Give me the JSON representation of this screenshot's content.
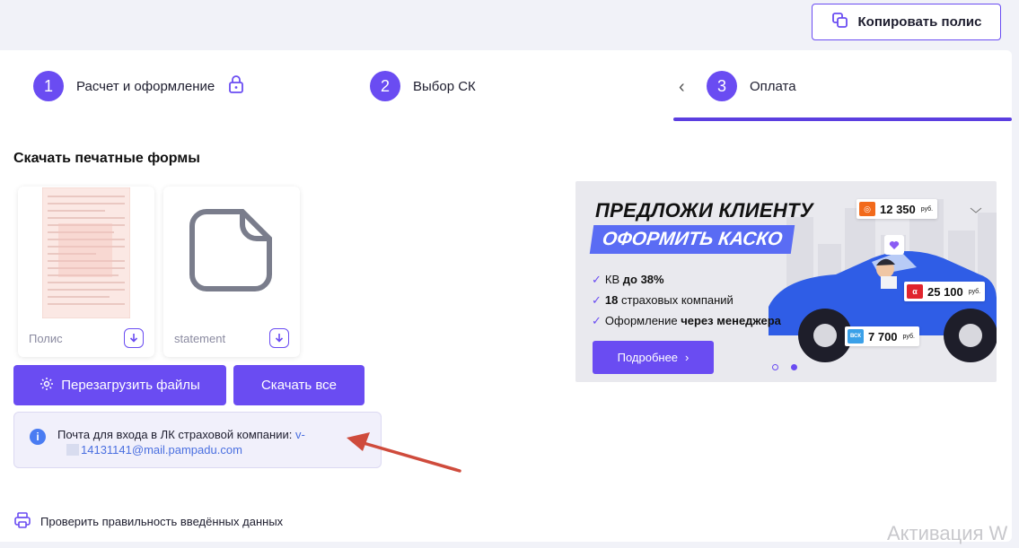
{
  "header": {
    "copy_button_label": "Копировать полис"
  },
  "stepper": {
    "steps": [
      {
        "num": "1",
        "label": "Расчет и оформление"
      },
      {
        "num": "2",
        "label": "Выбор СК"
      },
      {
        "num": "3",
        "label": "Оплата"
      }
    ],
    "active_step": 3
  },
  "downloads": {
    "title": "Скачать печатные формы",
    "files": [
      {
        "name": "Полис"
      },
      {
        "name": "statement"
      }
    ],
    "reload_button": "Перезагрузить файлы",
    "download_all_button": "Скачать все"
  },
  "info": {
    "text": "Почта для входа в ЛК страховой компании:",
    "email_prefix": "v-",
    "email_rest": "14131141@mail.pampadu.com"
  },
  "check_link": "Проверить правильность введённых данных",
  "banner": {
    "headline": "ПРЕДЛОЖИ КЛИЕНТУ",
    "subheadline": "ОФОРМИТЬ КАСКО",
    "bullets": [
      {
        "prefix": "КВ ",
        "bold": "до 38%",
        "suffix": ""
      },
      {
        "prefix": "",
        "bold": "18",
        "suffix": " страховых компаний"
      },
      {
        "prefix": "Оформление ",
        "bold": "через менеджера",
        "suffix": ""
      }
    ],
    "more_button": "Подробнее",
    "prices": [
      {
        "value": "12 350",
        "unit": "руб."
      },
      {
        "value": "25 100",
        "unit": "руб."
      },
      {
        "value": "7 700",
        "unit": "руб."
      }
    ]
  },
  "watermark": "Активация W",
  "colors": {
    "accent": "#6a4cf2",
    "link": "#4a6fe0",
    "info_bg": "#f1f0fb"
  }
}
